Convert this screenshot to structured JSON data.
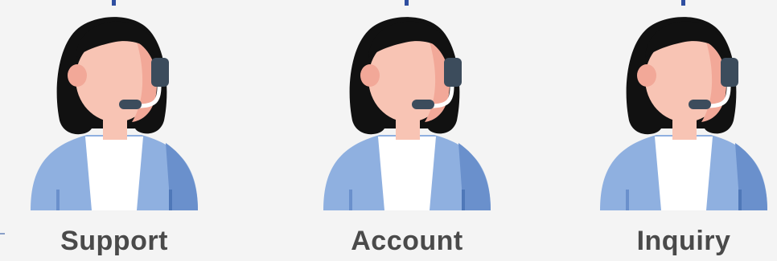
{
  "agents": [
    {
      "label": "Support"
    },
    {
      "label": "Account"
    },
    {
      "label": "Inquiry"
    }
  ],
  "colors": {
    "background": "#f4f4f4",
    "hair": "#111111",
    "skin": "#f8c4b4",
    "skin_shadow": "#f2a898",
    "headset": "#3c4c5c",
    "jacket": "#8fb0e0",
    "jacket_dark": "#6a90cc",
    "shirt": "#ffffff",
    "label_text": "#4a4a4a",
    "top_tick": "#2f4fa0"
  },
  "icon_name": "customer-service-agent-icon"
}
